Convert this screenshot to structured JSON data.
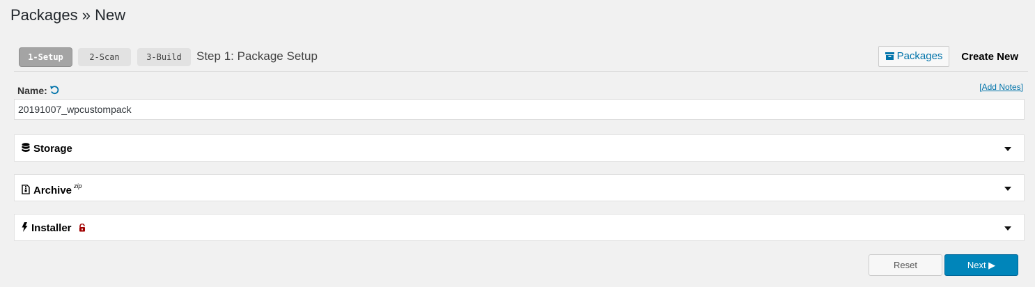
{
  "header": {
    "title": "Packages » New"
  },
  "steps": [
    {
      "label": "1-Setup",
      "active": true
    },
    {
      "label": "2-Scan",
      "active": false
    },
    {
      "label": "3-Build",
      "active": false
    }
  ],
  "step_title": "Step 1: Package Setup",
  "toolbar": {
    "packages_label": "Packages",
    "packages_icon": "archive-box-icon",
    "create_new_label": "Create New"
  },
  "name_field": {
    "label": "Name:",
    "value": "20191007_wpcustompack",
    "reset_icon": "undo-icon",
    "add_notes_label": "[Add Notes]"
  },
  "panels": {
    "storage": {
      "title": "Storage",
      "icon": "database-icon"
    },
    "archive": {
      "title": "Archive",
      "superscript": "zip",
      "icon": "zip-file-icon"
    },
    "installer": {
      "title": "Installer",
      "icon": "bolt-icon",
      "status_icon": "unlock-icon"
    }
  },
  "actions": {
    "reset_label": "Reset",
    "next_label": "Next ▶"
  },
  "colors": {
    "link": "#0073aa",
    "primary_button": "#0085ba",
    "lock": "#a00000",
    "background": "#f1f1f1"
  }
}
